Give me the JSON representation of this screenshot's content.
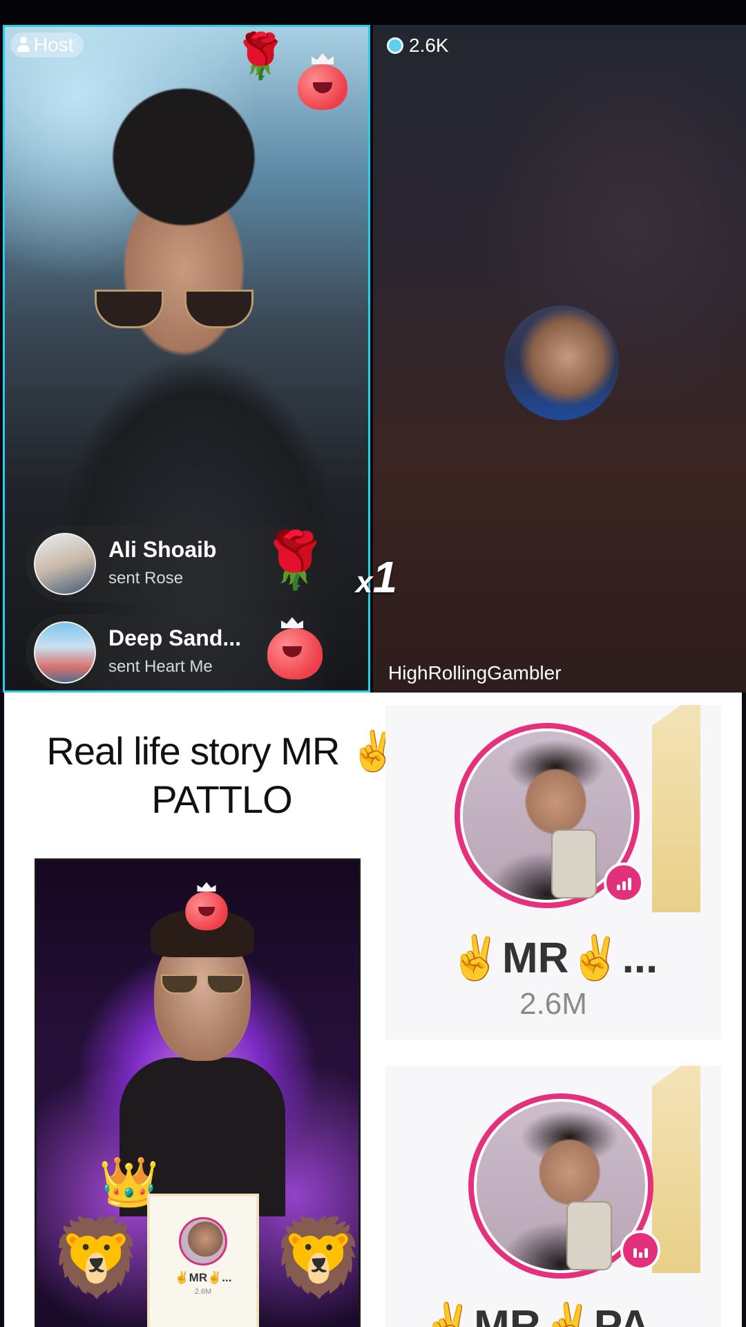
{
  "live": {
    "host_label": "Host",
    "coins": "2.6K",
    "opponent_name": "HighRollingGambler",
    "combo_prefix": "x",
    "combo_value": "1",
    "gifts": [
      {
        "name": "Ali Shoaib",
        "desc": "sent Rose"
      },
      {
        "name": "Deep Sand...",
        "desc": "sent Heart Me"
      }
    ]
  },
  "story": {
    "title_line1": "Real life story MR ✌️",
    "title_line2": "PATTLO"
  },
  "poster": {
    "mini_name": "✌️MR✌️...",
    "mini_count": "2.6M"
  },
  "cards": [
    {
      "name": "✌️MR✌️...",
      "count": "2.6M"
    },
    {
      "name": "✌️MR✌️PA..."
    }
  ],
  "icons": {
    "host": "person-icon",
    "coins": "gem-icon",
    "live": "live-bars-icon",
    "rose": "🌹",
    "lion": "🦁",
    "crown": "👑"
  },
  "colors": {
    "host_border": "#27d0e6",
    "live_ring": "#e5307d",
    "gold": "#e9cf88"
  }
}
